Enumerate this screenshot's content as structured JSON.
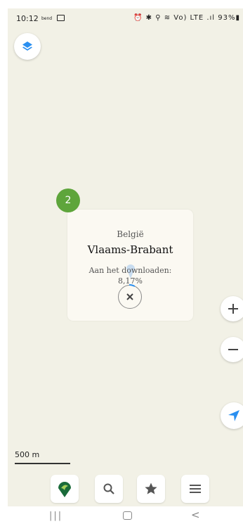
{
  "status_bar": {
    "time": "10:12",
    "tag": "bend",
    "right": "⏰ ✱ ⚲ ≋ Vo) LTE .ıl 93%▮"
  },
  "download_card": {
    "badge": "2",
    "country": "België",
    "region": "Vlaams-Brabant",
    "status": "Aan het downloaden:",
    "percent": "8,17%",
    "progress": 0.0817
  },
  "map": {
    "scale_label": "500 m"
  },
  "colors": {
    "accent": "#2a8ff0",
    "badge": "#5ea53b",
    "logo": "#1a6b3a",
    "map_bg": "#f2f1e6"
  },
  "icons": {
    "layers": "layers-icon",
    "zoom_in": "plus-icon",
    "zoom_out": "minus-icon",
    "locate": "navigation-arrow-icon",
    "search": "search-icon",
    "favorites": "star-icon",
    "menu": "menu-icon"
  },
  "nav": {
    "recent": "|||",
    "back": "<"
  }
}
